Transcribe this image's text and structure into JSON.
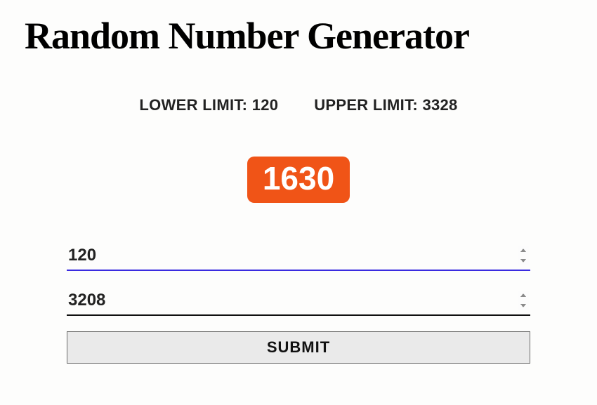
{
  "title": "Random Number Generator",
  "limits": {
    "lower_label": "LOWER LIMIT:",
    "lower_value": "120",
    "upper_label": "UPPER LIMIT:",
    "upper_value": "3328"
  },
  "result": "1630",
  "inputs": {
    "lower_value": "120",
    "upper_value": "3208"
  },
  "submit_label": "SUBMIT"
}
